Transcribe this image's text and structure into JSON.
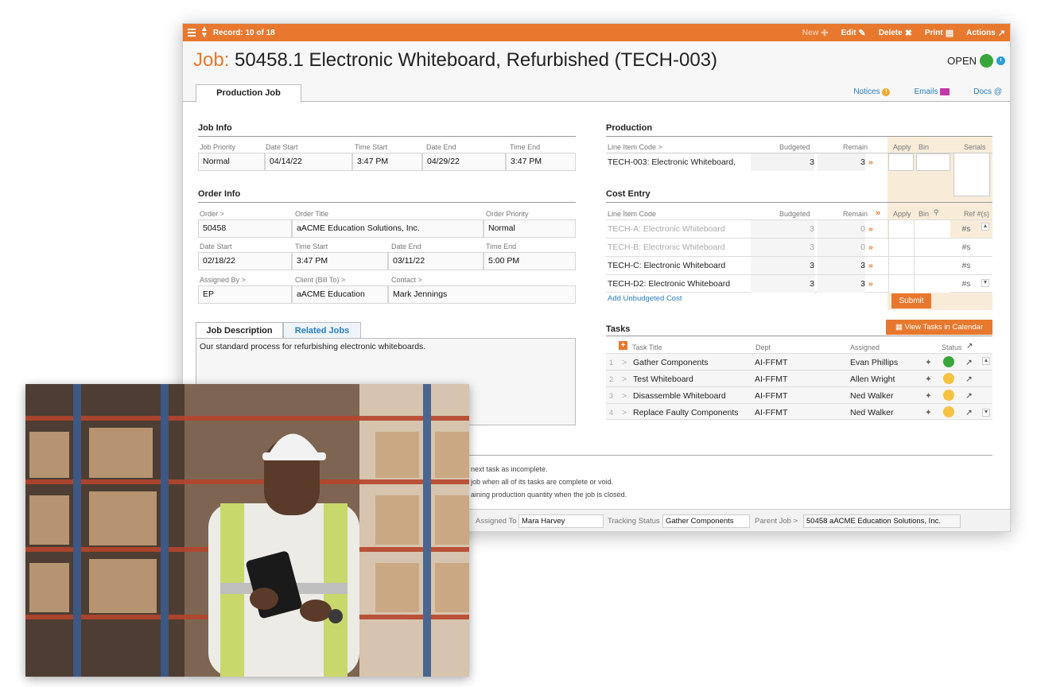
{
  "topbar": {
    "record": "Record: 10 of 18",
    "new": "New",
    "edit": "Edit",
    "delete": "Delete",
    "print": "Print",
    "actions": "Actions"
  },
  "header": {
    "label": "Job:",
    "title": "50458.1 Electronic Whiteboard, Refurbished (TECH-003)",
    "status": "OPEN"
  },
  "tabs": {
    "main": "Production Job"
  },
  "util_links": {
    "notices": "Notices",
    "emails": "Emails",
    "docs": "Docs"
  },
  "job_info": {
    "title": "Job Info",
    "labels": [
      "Job Priority",
      "Date Start",
      "Time Start",
      "Date End",
      "Time End"
    ],
    "values": [
      "Normal",
      "04/14/22",
      "3:47 PM",
      "04/29/22",
      "3:47 PM"
    ]
  },
  "order_info": {
    "title": "Order Info",
    "row1_labels": [
      "Order >",
      "Order Title",
      "Order Priority"
    ],
    "row1_values": [
      "50458",
      "aACME Education Solutions, Inc.",
      "Normal"
    ],
    "row2_labels": [
      "Date Start",
      "Time Start",
      "Date End",
      "Time End"
    ],
    "row2_values": [
      "02/18/22",
      "3:47 PM",
      "03/11/22",
      "5:00 PM"
    ],
    "row3_labels": [
      "Assigned By >",
      "Client (Bill To) >",
      "Contact >"
    ],
    "row3_values": [
      "EP",
      "aACME Education",
      "Mark Jennings"
    ]
  },
  "production": {
    "title": "Production",
    "headers": [
      "Line Item Code >",
      "Budgeted",
      "Remain",
      "Apply",
      "Bin",
      "Serials"
    ],
    "row": {
      "code": "TECH-003: Electronic Whiteboard,",
      "budgeted": "3",
      "remain": "3"
    }
  },
  "cost_entry": {
    "title": "Cost Entry",
    "headers": [
      "Line Item Code",
      "Budgeted",
      "Remain",
      "Apply",
      "Bin",
      "Ref #(s)"
    ],
    "rows": [
      {
        "code": "TECH-A: Electronic Whiteboard",
        "budgeted": "3",
        "remain": "0",
        "ref": "#s"
      },
      {
        "code": "TECH-B: Electronic Whiteboard",
        "budgeted": "3",
        "remain": "0",
        "ref": "#s"
      },
      {
        "code": "TECH-C: Electronic Whiteboard",
        "budgeted": "3",
        "remain": "3",
        "ref": "#s"
      },
      {
        "code": "TECH-D2: Electronic Whiteboard",
        "budgeted": "3",
        "remain": "3",
        "ref": "#s"
      }
    ],
    "add_link": "Add Unbudgeted Cost",
    "submit": "Submit"
  },
  "tasks": {
    "title": "Tasks",
    "calendar_btn": "View Tasks in Calendar",
    "headers": [
      "Task Title",
      "Dept",
      "Assigned",
      "Status"
    ],
    "rows": [
      {
        "num": "1",
        "title": "Gather Components",
        "dept": "AI-FFMT",
        "assigned": "Evan Phillips",
        "status_color": "#3aa63a"
      },
      {
        "num": "2",
        "title": "Test Whiteboard",
        "dept": "AI-FFMT",
        "assigned": "Allen Wright",
        "status_color": "#f5c242"
      },
      {
        "num": "3",
        "title": "Disassemble Whiteboard",
        "dept": "AI-FFMT",
        "assigned": "Ned Walker",
        "status_color": "#f5c242"
      },
      {
        "num": "4",
        "title": "Replace Faulty Components",
        "dept": "AI-FFMT",
        "assigned": "Ned Walker",
        "status_color": "#f5c242"
      }
    ]
  },
  "description": {
    "tab_active": "Job Description",
    "tab_other": "Related Jobs",
    "text": "Our standard process for refurbishing electronic whiteboards."
  },
  "notes": [
    "next task as incomplete.",
    "job when all of its tasks are complete or void.",
    "aining production quantity when the job is closed."
  ],
  "footer": {
    "assigned_to_label": "Assigned To",
    "assigned_to": "Mara Harvey",
    "tracking_label": "Tracking Status",
    "tracking": "Gather Components",
    "parent_label": "Parent Job >",
    "parent": "50458 aACME Education Solutions, Inc."
  }
}
